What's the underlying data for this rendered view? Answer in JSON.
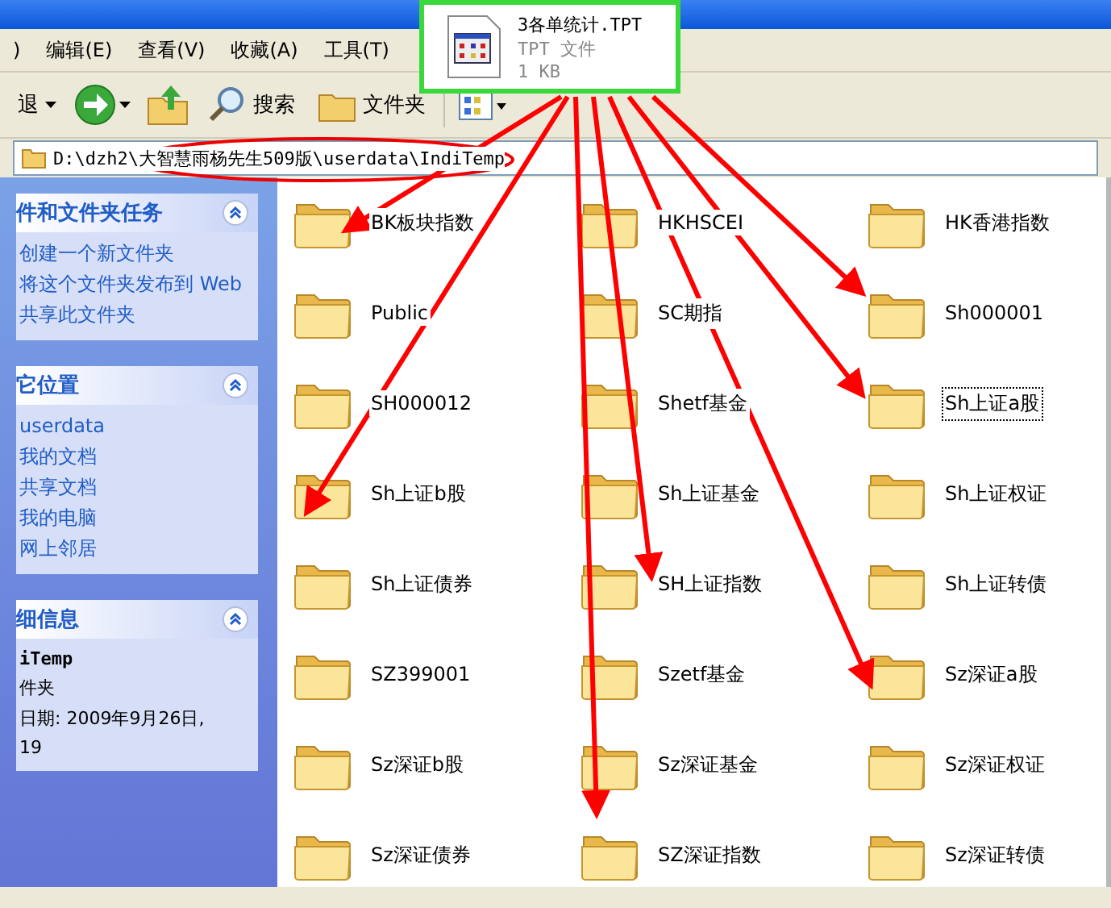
{
  "menu": [
    ")",
    "编辑(E)",
    "查看(V)",
    "收藏(A)",
    "工具(T)"
  ],
  "toolbar": [
    {
      "kind": "back",
      "label": "退"
    },
    {
      "kind": "forward"
    },
    {
      "kind": "up"
    },
    {
      "kind": "search",
      "label": "搜索"
    },
    {
      "kind": "folders",
      "label": "文件夹"
    },
    {
      "kind": "views"
    }
  ],
  "address": "D:\\dzh2\\大智慧雨杨先生509版\\userdata\\IndiTemp",
  "tooltip": {
    "name": "3各单统计.TPT",
    "type": "TPT 文件",
    "size": "1 KB"
  },
  "sidebar": [
    {
      "title": "件和文件夹任务",
      "kind": "links",
      "items": [
        "创建一个新文件夹",
        "将这个文件夹发布到 Web",
        "共享此文件夹"
      ]
    },
    {
      "title": "它位置",
      "kind": "links",
      "items": [
        "userdata",
        "我的文档",
        "共享文档",
        "我的电脑",
        "网上邻居"
      ]
    },
    {
      "title": "细信息",
      "kind": "details",
      "items": [
        "iTemp",
        "件夹",
        "日期: 2009年9月26日,",
        "19"
      ]
    }
  ],
  "folders": [
    {
      "name": "BK板块指数",
      "selected": false
    },
    {
      "name": "HKHSCEI",
      "selected": false
    },
    {
      "name": "HK香港指数",
      "selected": false
    },
    {
      "name": "Public",
      "selected": false
    },
    {
      "name": "SC期指",
      "selected": false
    },
    {
      "name": "Sh000001",
      "selected": false
    },
    {
      "name": "SH000012",
      "selected": false
    },
    {
      "name": "Shetf基金",
      "selected": false
    },
    {
      "name": "Sh上证a股",
      "selected": true
    },
    {
      "name": "Sh上证b股",
      "selected": false
    },
    {
      "name": "Sh上证基金",
      "selected": false
    },
    {
      "name": "Sh上证权证",
      "selected": false
    },
    {
      "name": "Sh上证债券",
      "selected": false
    },
    {
      "name": "SH上证指数",
      "selected": false
    },
    {
      "name": "Sh上证转债",
      "selected": false
    },
    {
      "name": "SZ399001",
      "selected": false
    },
    {
      "name": "Szetf基金",
      "selected": false
    },
    {
      "name": "Sz深证a股",
      "selected": false
    },
    {
      "name": "Sz深证b股",
      "selected": false
    },
    {
      "name": "Sz深证基金",
      "selected": false
    },
    {
      "name": "Sz深证权证",
      "selected": false
    },
    {
      "name": "Sz深证债券",
      "selected": false
    },
    {
      "name": "SZ深证指数",
      "selected": false
    },
    {
      "name": "Sz深证转债",
      "selected": false
    }
  ]
}
